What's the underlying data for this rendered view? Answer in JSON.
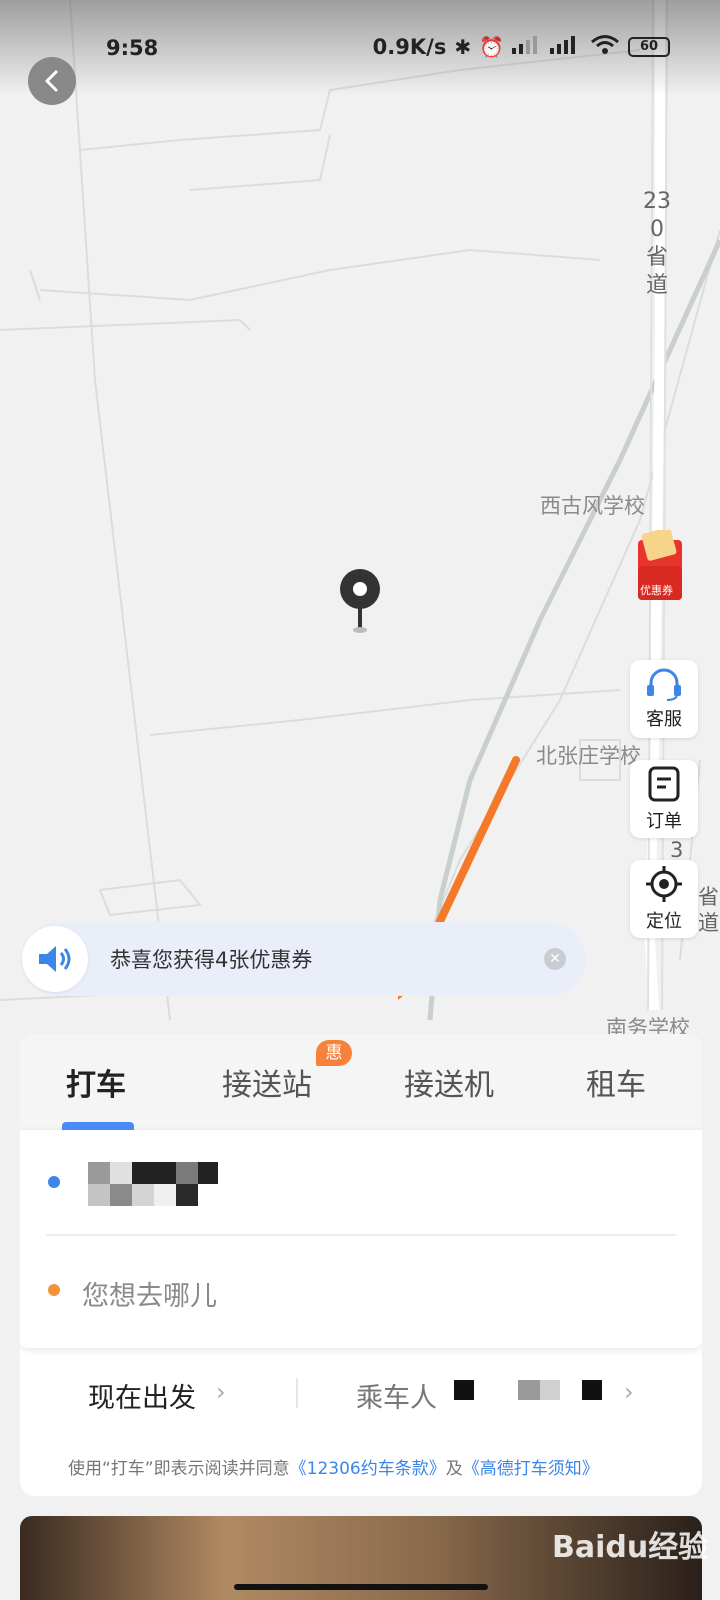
{
  "status_bar": {
    "time": "9:58",
    "net_speed": "0.9K/s",
    "battery": "60",
    "icons": [
      "bluetooth-icon",
      "alarm-icon",
      "signal-icon",
      "signal-hd-icon",
      "wifi-icon",
      "battery-icon"
    ]
  },
  "map": {
    "labels": {
      "road_230": "230省道",
      "xigufeng_school": "西古风学校",
      "beizhangzhuang_school": "北张庄学校",
      "nanwu_school": "南务学校",
      "road_right_fragment": "3",
      "road_right_fragment2": "省道"
    },
    "coupon_float_label": "优惠券"
  },
  "side_buttons": {
    "service": "客服",
    "orders": "订单",
    "locate": "定位"
  },
  "toast": {
    "text": "恭喜您获得4张优惠券"
  },
  "tabs": [
    {
      "label": "打车",
      "active": true
    },
    {
      "label": "接送站",
      "badge": "惠"
    },
    {
      "label": "接送机"
    },
    {
      "label": "租车"
    }
  ],
  "address": {
    "origin_dot_color": "#3b86e6",
    "dest_dot_color": "#f5913a",
    "dest_placeholder": "您想去哪儿"
  },
  "departure": {
    "time_label": "现在出发",
    "passenger_label": "乘车人"
  },
  "agreement": {
    "prefix": "使用“打车”即表示阅读并同意",
    "link1": "《12306约车条款》",
    "conj": "及",
    "link2": "《高德打车须知》"
  },
  "watermark": "Baidu经验",
  "colors": {
    "accent": "#4b8bf5",
    "badge": "#f5813a",
    "arrow": "#f47a2a"
  }
}
